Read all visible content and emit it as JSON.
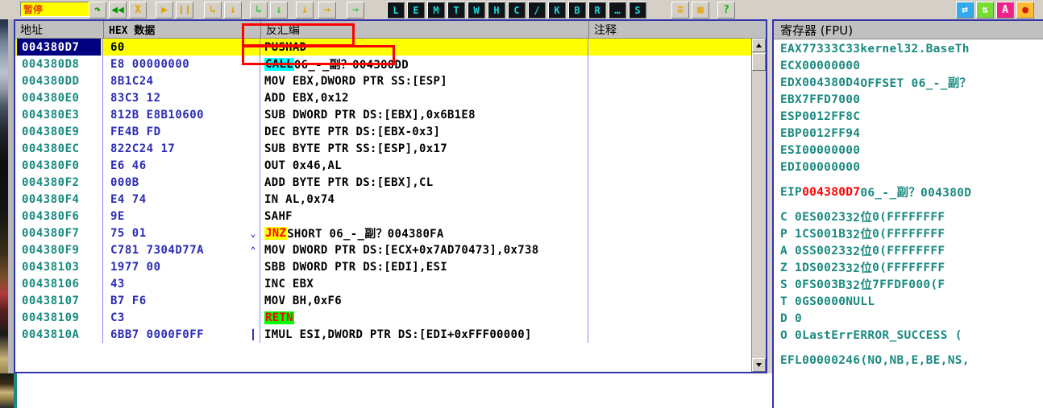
{
  "window": {
    "app": "OllyDbg",
    "status_label": "暂停"
  },
  "toolbar": {
    "nav_buttons": [
      {
        "name": "restart-button",
        "glyph": "↷",
        "color": "#009900"
      },
      {
        "name": "step-back-button",
        "glyph": "◀◀",
        "color": "#009900"
      },
      {
        "name": "close-program-button",
        "glyph": "X",
        "color": "#e8a300"
      },
      {
        "name": "run-button",
        "glyph": "▶",
        "color": "#e8a300"
      },
      {
        "name": "pause-button",
        "glyph": "❙❙",
        "color": "#e8a300"
      },
      {
        "name": "step-into-button",
        "glyph": "↳",
        "color": "#e8a300"
      },
      {
        "name": "step-over-button",
        "glyph": "↓",
        "color": "#e8a300"
      },
      {
        "name": "trace-into-button",
        "glyph": "↳",
        "color": "#33cc33"
      },
      {
        "name": "trace-over-button",
        "glyph": "↓",
        "color": "#33cc33"
      },
      {
        "name": "execute-till-return-button",
        "glyph": "↓",
        "color": "#e8a300"
      },
      {
        "name": "execute-till-cursor-button",
        "glyph": "→",
        "color": "#e8a300"
      },
      {
        "name": "animate-button",
        "glyph": "→",
        "color": "#33cc33"
      }
    ],
    "letter_buttons": [
      "L",
      "E",
      "M",
      "T",
      "W",
      "H",
      "C",
      "/",
      "K",
      "B",
      "R",
      "…",
      "S"
    ],
    "view_buttons": [
      {
        "name": "options-button",
        "glyph": "≡",
        "color": "#e8a300"
      },
      {
        "name": "window-tile-button",
        "glyph": "▦",
        "color": "#e8a300"
      },
      {
        "name": "help-button",
        "glyph": "?",
        "color": "#00bb00"
      }
    ],
    "right_buttons": [
      {
        "name": "swap-arrows-icon",
        "glyph": "⇄",
        "bg": "#33aaee",
        "fg": "#ffffff"
      },
      {
        "name": "updown-arrows-icon",
        "glyph": "⇅",
        "bg": "#77dd33",
        "fg": "#ffffff"
      },
      {
        "name": "letter-a-icon",
        "glyph": "A",
        "bg": "#ee2288",
        "fg": "#ffffff"
      },
      {
        "name": "record-icon",
        "glyph": "●",
        "bg": "#ffbb33",
        "fg": "#cc2200"
      }
    ]
  },
  "disassembly": {
    "columns": [
      {
        "key": "address",
        "label": "地址",
        "mono": false
      },
      {
        "key": "hex",
        "label": "HEX 数据",
        "mono": true
      },
      {
        "key": "disasm",
        "label": "反汇编",
        "mono": false
      },
      {
        "key": "comment",
        "label": "注释",
        "mono": false
      }
    ],
    "rows": [
      {
        "address": "004380D7",
        "hex": "60",
        "mark": "",
        "kw": "",
        "disasm": "PUSHAD",
        "comment": "",
        "selected": true
      },
      {
        "address": "004380D8",
        "hex": "E8 00000000",
        "mark": "",
        "kw": "CALL",
        "kwclass": "kw-call",
        "disasm": " 06_-_副？004380DD",
        "comment": ""
      },
      {
        "address": "004380DD",
        "hex": "8B1C24",
        "mark": "",
        "kw": "",
        "disasm": "MOV EBX,DWORD PTR SS:[ESP]",
        "comment": ""
      },
      {
        "address": "004380E0",
        "hex": "83C3 12",
        "mark": "",
        "kw": "",
        "disasm": "ADD EBX,0x12",
        "comment": ""
      },
      {
        "address": "004380E3",
        "hex": "812B E8B10600",
        "mark": "",
        "kw": "",
        "disasm": "SUB DWORD PTR DS:[EBX],0x6B1E8",
        "comment": ""
      },
      {
        "address": "004380E9",
        "hex": "FE4B FD",
        "mark": "",
        "kw": "",
        "disasm": "DEC BYTE PTR DS:[EBX-0x3]",
        "comment": ""
      },
      {
        "address": "004380EC",
        "hex": "822C24 17",
        "mark": "",
        "kw": "",
        "disasm": "SUB BYTE PTR SS:[ESP],0x17",
        "comment": ""
      },
      {
        "address": "004380F0",
        "hex": "E6 46",
        "mark": "",
        "kw": "",
        "disasm": "OUT 0x46,AL",
        "comment": ""
      },
      {
        "address": "004380F2",
        "hex": "000B",
        "mark": "",
        "kw": "",
        "disasm": "ADD BYTE PTR DS:[EBX],CL",
        "comment": ""
      },
      {
        "address": "004380F4",
        "hex": "E4 74",
        "mark": "",
        "kw": "",
        "disasm": "IN AL,0x74",
        "comment": ""
      },
      {
        "address": "004380F6",
        "hex": "9E",
        "mark": "",
        "kw": "",
        "disasm": "SAHF",
        "comment": ""
      },
      {
        "address": "004380F7",
        "hex": "75 01",
        "mark": "⌄",
        "kw": "JNZ",
        "kwclass": "kw-jnz",
        "disasm": " SHORT 06_-_副？004380FA",
        "comment": ""
      },
      {
        "address": "004380F9",
        "hex": "C781 7304D77A",
        "mark": "⌃",
        "kw": "",
        "disasm": "MOV DWORD PTR DS:[ECX+0x7AD70473],0x738",
        "comment": ""
      },
      {
        "address": "00438103",
        "hex": "1977 00",
        "mark": "",
        "kw": "",
        "disasm": "SBB DWORD PTR DS:[EDI],ESI",
        "comment": ""
      },
      {
        "address": "00438106",
        "hex": "43",
        "mark": "",
        "kw": "",
        "disasm": "INC EBX",
        "comment": ""
      },
      {
        "address": "00438107",
        "hex": "B7 F6",
        "mark": "",
        "kw": "",
        "disasm": "MOV BH,0xF6",
        "comment": ""
      },
      {
        "address": "00438109",
        "hex": "C3",
        "mark": "",
        "kw": "RETN",
        "kwclass": "kw-retn",
        "disasm": "",
        "comment": ""
      },
      {
        "address": "0043810A",
        "hex": "6BB7 0000F0FF",
        "mark": "┃",
        "kw": "",
        "disasm": "IMUL ESI,DWORD PTR DS:[EDI+0xFFF00000]",
        "comment": ""
      }
    ]
  },
  "registers": {
    "title": "寄存器 (FPU)",
    "general": [
      {
        "name": "EAX",
        "value": "77333C33",
        "note": "kernel32.BaseTh"
      },
      {
        "name": "ECX",
        "value": "00000000",
        "note": ""
      },
      {
        "name": "EDX",
        "value": "004380D4",
        "note": "OFFSET 06_-_副？"
      },
      {
        "name": "EBX",
        "value": "7FFD7000",
        "note": ""
      },
      {
        "name": "ESP",
        "value": "0012FF8C",
        "note": ""
      },
      {
        "name": "EBP",
        "value": "0012FF94",
        "note": ""
      },
      {
        "name": "ESI",
        "value": "00000000",
        "note": ""
      },
      {
        "name": "EDI",
        "value": "00000000",
        "note": ""
      }
    ],
    "eip": {
      "name": "EIP",
      "value": "004380D7",
      "note": "06_-_副？004380D"
    },
    "flags": [
      {
        "flag": "C",
        "bit": "0",
        "seg": "ES",
        "sel": "0023",
        "mode": "32位",
        "base": "0(FFFFFFFF"
      },
      {
        "flag": "P",
        "bit": "1",
        "seg": "CS",
        "sel": "001B",
        "mode": "32位",
        "base": "0(FFFFFFFF"
      },
      {
        "flag": "A",
        "bit": "0",
        "seg": "SS",
        "sel": "0023",
        "mode": "32位",
        "base": "0(FFFFFFFF"
      },
      {
        "flag": "Z",
        "bit": "1",
        "seg": "DS",
        "sel": "0023",
        "mode": "32位",
        "base": "0(FFFFFFFF"
      },
      {
        "flag": "S",
        "bit": "0",
        "seg": "FS",
        "sel": "003B",
        "mode": "32位",
        "base": "7FFDF000(F"
      },
      {
        "flag": "T",
        "bit": "0",
        "seg": "GS",
        "sel": "0000",
        "mode": "NULL",
        "base": ""
      },
      {
        "flag": "D",
        "bit": "0",
        "seg": "",
        "sel": "",
        "mode": "",
        "base": ""
      },
      {
        "flag": "O",
        "bit": "0",
        "seg": "",
        "sel": "LastErr",
        "mode": "ERROR_SUCCESS (",
        "base": ""
      }
    ],
    "efl": {
      "label": "EFL",
      "value": "00000246",
      "note": "(NO,NB,E,BE,NS,"
    }
  },
  "colors": {
    "selected_row_bg": "#ffff00",
    "address_text": "#1a8a80",
    "hex_text": "#2b2bb5",
    "eip_red": "#ff0000",
    "annotation_red": "#ff0000",
    "pane_border": "#3333aa"
  }
}
